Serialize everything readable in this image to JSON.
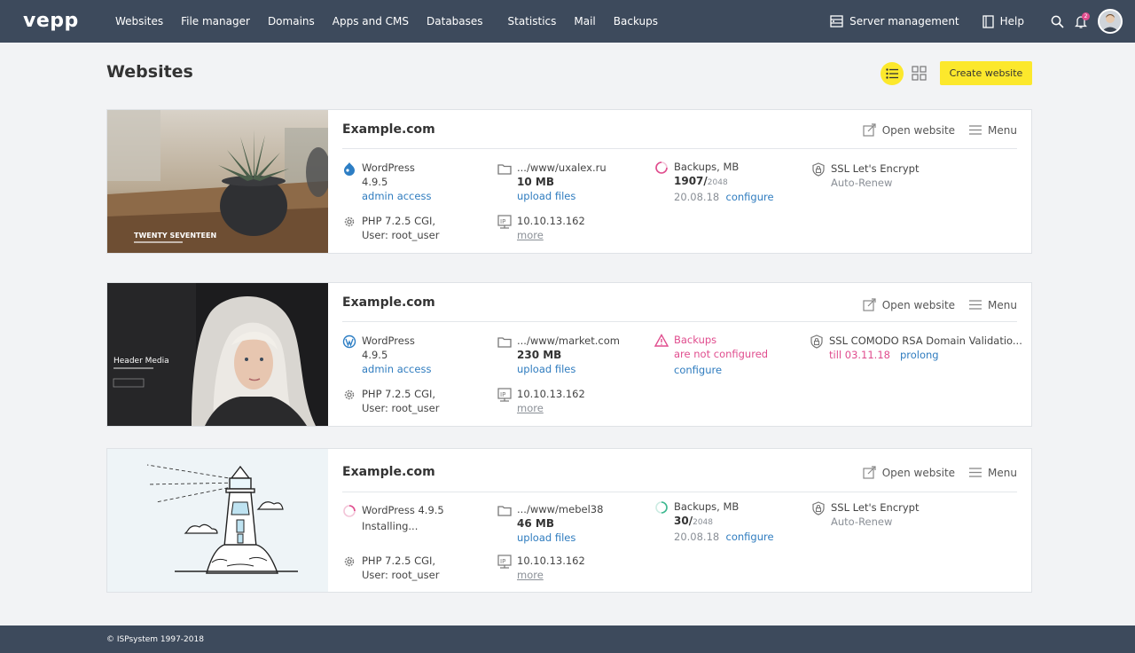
{
  "nav": {
    "logo": "vepp",
    "items": [
      "Websites",
      "File manager",
      "Domains",
      "Apps and CMS",
      "Databases",
      "Statistics",
      "Mail",
      "Backups"
    ],
    "server_management": "Server management",
    "help": "Help",
    "notification_count": "2"
  },
  "page": {
    "title": "Websites",
    "create_button": "Create website"
  },
  "card_actions": {
    "open_website": "Open website",
    "menu": "Menu"
  },
  "sites": [
    {
      "name": "Example.com",
      "thumb_title": "TWENTY SEVENTEEN",
      "cms": "WordPress",
      "cms_version": "4.9.5",
      "admin_access": "admin access",
      "php": "PHP 7.2.5 CGI,",
      "user": "User: root_user",
      "path": ".../www/uxalex.ru",
      "size": "10 MB",
      "upload_files": "upload files",
      "ip": "10.10.13.162",
      "more": "more",
      "backups_label": "Backups, MB",
      "backups_used": "1907/",
      "backups_total": "2048",
      "backups_date": "20.08.18",
      "backups_configure": "configure",
      "ssl": "SSL Let's Encrypt",
      "ssl_sub": "Auto-Renew"
    },
    {
      "name": "Example.com",
      "thumb_title": "Header Media",
      "cms": "WordPress",
      "cms_version": "4.9.5",
      "admin_access": "admin access",
      "php": "PHP 7.2.5 CGI,",
      "user": "User: root_user",
      "path": ".../www/market.com",
      "size": "230 MB",
      "upload_files": "upload files",
      "ip": "10.10.13.162",
      "more": "more",
      "backups_label": "Backups",
      "backups_warning": "are not configured",
      "backups_configure": "configure",
      "ssl": "SSL COMODO RSA Domain Validatio...",
      "ssl_till": "till 03.11.18",
      "ssl_prolong": "prolong"
    },
    {
      "name": "Example.com",
      "cms": "WordPress 4.9.5",
      "installing": "Installing...",
      "php": "PHP 7.2.5 CGI,",
      "user": "User: root_user",
      "path": ".../www/mebel38",
      "size": "46 MB",
      "upload_files": "upload files",
      "ip": "10.10.13.162",
      "more": "more",
      "backups_label": "Backups, MB",
      "backups_used": "30/",
      "backups_total": "2048",
      "backups_date": "20.08.18",
      "backups_configure": "configure",
      "ssl": "SSL Let's Encrypt",
      "ssl_sub": "Auto-Renew"
    }
  ],
  "footer": {
    "copyright": "© ISPsystem 1997-2018"
  },
  "colors": {
    "nav_bg": "#3d4a5c",
    "accent_yellow": "#fce82c",
    "link_blue": "#2f7cbf",
    "warning_pink": "#e04d8e"
  }
}
